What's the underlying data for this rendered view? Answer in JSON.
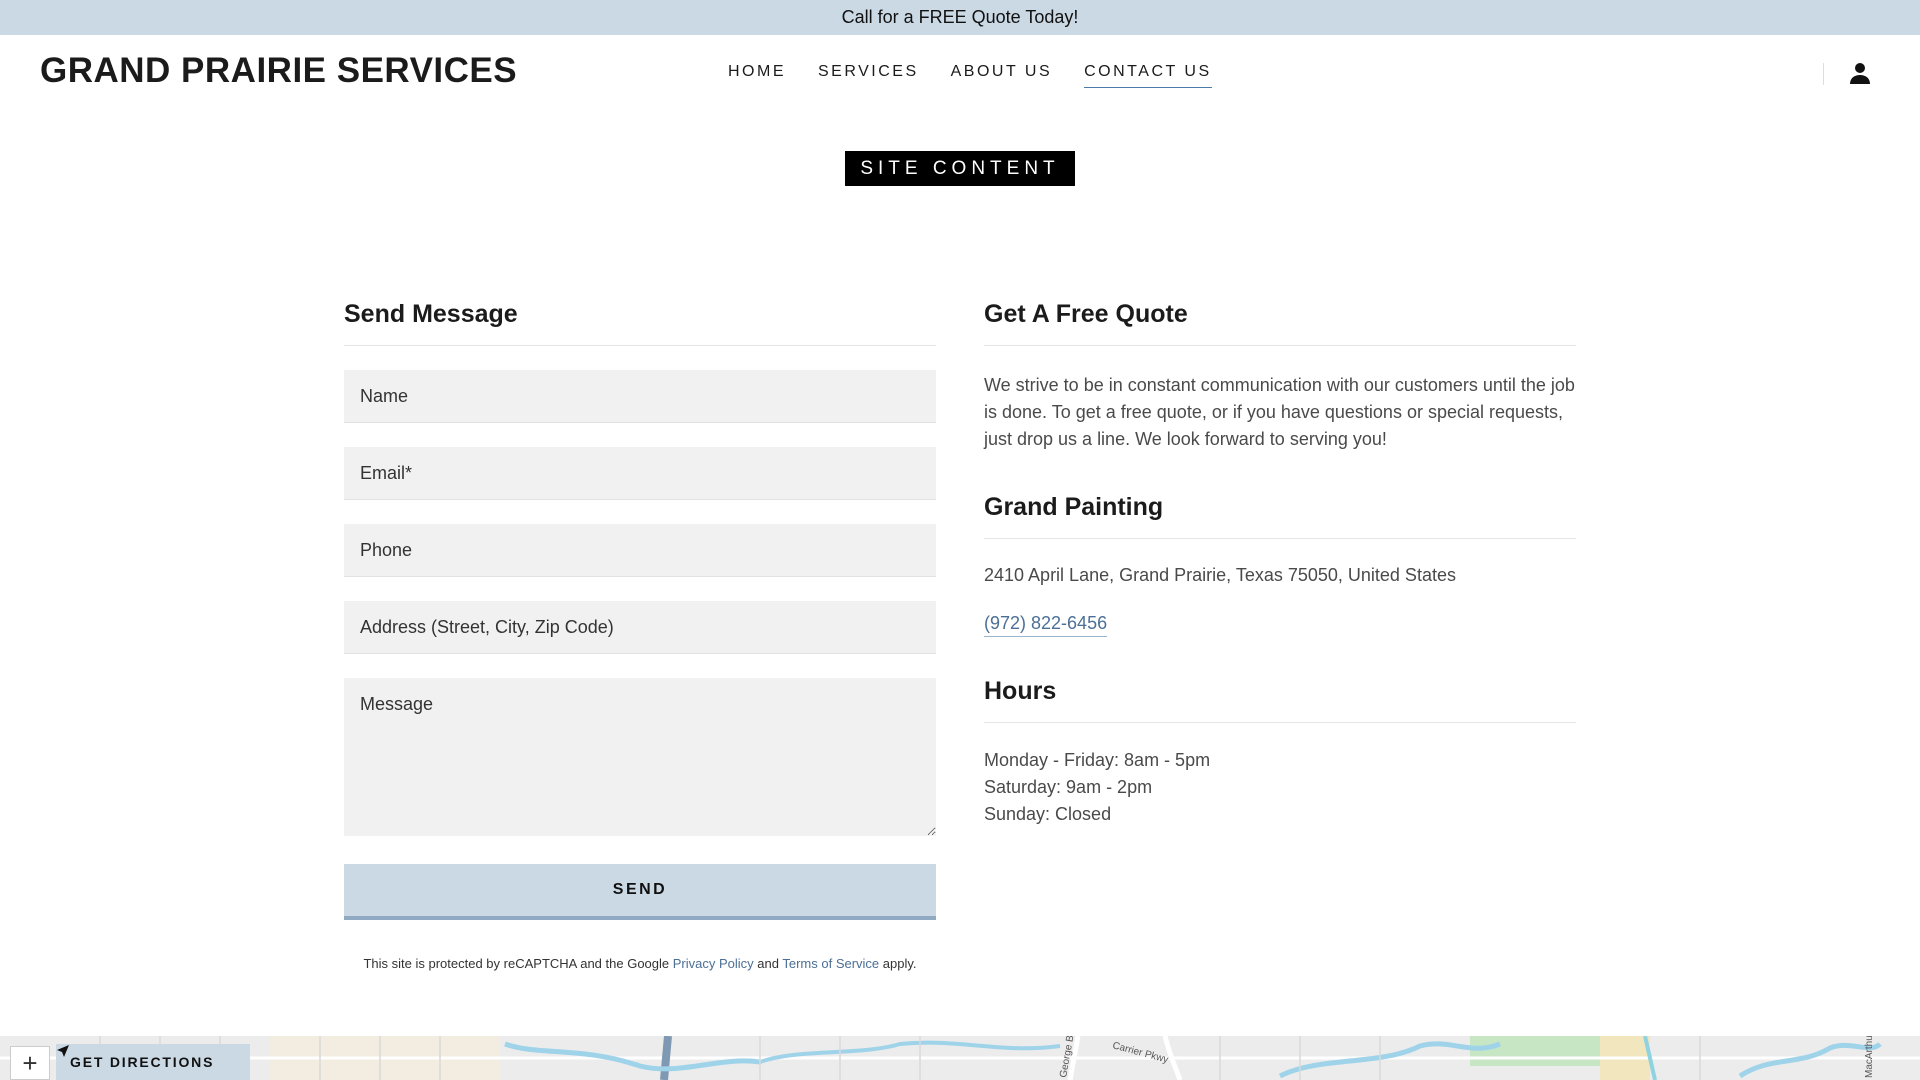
{
  "announcement": "Call for a FREE Quote Today!",
  "brand": "GRAND PRAIRIE SERVICES",
  "nav": {
    "items": [
      {
        "label": "HOME"
      },
      {
        "label": "SERVICES"
      },
      {
        "label": "ABOUT US"
      },
      {
        "label": "CONTACT US",
        "active": true
      }
    ]
  },
  "badge": "SITE CONTENT",
  "form": {
    "title": "Send Message",
    "name_placeholder": "Name",
    "email_placeholder": "Email*",
    "phone_placeholder": "Phone",
    "address_placeholder": "Address (Street, City, Zip Code)",
    "message_placeholder": "Message",
    "send_label": "SEND",
    "recaptcha": {
      "pre": "This site is protected by reCAPTCHA and the Google ",
      "privacy": "Privacy Policy",
      "mid": " and ",
      "terms": "Terms of Service",
      "post": " apply."
    }
  },
  "quote": {
    "title": "Get A Free Quote",
    "text": "We strive to be in constant communication with our customers until the job is done. To get a free quote, or if you have questions or special requests, just drop us a line. We look forward to serving you!"
  },
  "business": {
    "title": "Grand Painting",
    "address": "2410 April Lane, Grand Prairie, Texas 75050, United States",
    "phone": "(972) 822-6456"
  },
  "hours": {
    "title": "Hours",
    "lines": [
      "Monday - Friday: 8am - 5pm",
      "Saturday: 9am - 2pm",
      "Sunday: Closed"
    ]
  },
  "map": {
    "zoom_symbol": "+",
    "directions_label": "GET DIRECTIONS",
    "labels": [
      "George Bush",
      "Carrier Pkwy",
      "MacArthur"
    ]
  },
  "colors": {
    "accent": "#cbd9e5",
    "link": "#4b6f96",
    "badge_bg": "#000000"
  }
}
